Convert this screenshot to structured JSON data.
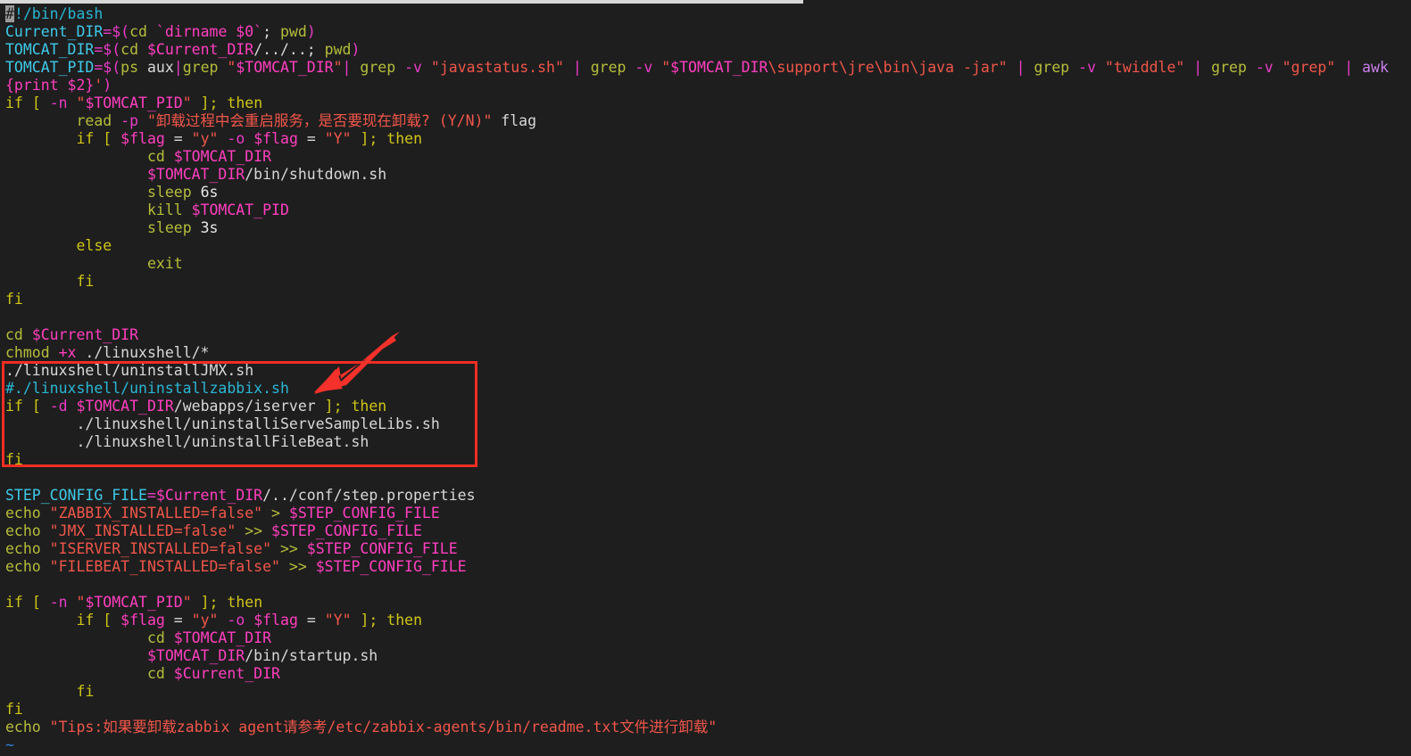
{
  "window": {
    "title": "uninstall.sh",
    "editor": "vim",
    "background_color": "#1e1e1e"
  },
  "annotations": {
    "box": {
      "color": "#ef2d24",
      "shape": "rectangle",
      "highlights_lines": [
        20,
        21,
        22,
        23,
        24,
        25
      ]
    },
    "arrow": {
      "color": "#f4312a",
      "shape": "arrow",
      "direction": "down-left",
      "points_at": "#./linuxshell/uninstallzabbix.sh"
    }
  },
  "filler": {
    "tilde": "~"
  },
  "lines": [
    {
      "n": 1,
      "tokens": [
        {
          "t": "#",
          "c": "cursor"
        },
        {
          "t": "!/bin/bash",
          "c": "c-cmt"
        }
      ]
    },
    {
      "n": 2,
      "tokens": [
        {
          "t": "Current_DIR",
          "c": "c-var"
        },
        {
          "t": "=$(",
          "c": "c-op"
        },
        {
          "t": "cd ",
          "c": "c-cmd"
        },
        {
          "t": "`dirname $0`",
          "c": "c-dollar"
        },
        {
          "t": "; ",
          "c": "c-ident"
        },
        {
          "t": "pwd",
          "c": "c-cmd"
        },
        {
          "t": ")",
          "c": "c-op"
        }
      ]
    },
    {
      "n": 3,
      "tokens": [
        {
          "t": "TOMCAT_DIR",
          "c": "c-var"
        },
        {
          "t": "=$(",
          "c": "c-op"
        },
        {
          "t": "cd ",
          "c": "c-cmd"
        },
        {
          "t": "$Current_DIR",
          "c": "c-dollar"
        },
        {
          "t": "/../..; ",
          "c": "c-ident"
        },
        {
          "t": "pwd",
          "c": "c-cmd"
        },
        {
          "t": ")",
          "c": "c-op"
        }
      ]
    },
    {
      "n": 4,
      "tokens": [
        {
          "t": "TOMCAT_PID",
          "c": "c-var"
        },
        {
          "t": "=$(",
          "c": "c-op"
        },
        {
          "t": "ps ",
          "c": "c-cmd"
        },
        {
          "t": "aux",
          "c": "c-ident"
        },
        {
          "t": "|",
          "c": "c-pipe"
        },
        {
          "t": "grep ",
          "c": "c-cmd"
        },
        {
          "t": "\"",
          "c": "c-str"
        },
        {
          "t": "$TOMCAT_DIR",
          "c": "c-dollar"
        },
        {
          "t": "\"",
          "c": "c-str"
        },
        {
          "t": "| ",
          "c": "c-pipe"
        },
        {
          "t": "grep ",
          "c": "c-cmd"
        },
        {
          "t": "-v ",
          "c": "c-flag"
        },
        {
          "t": "\"javastatus.sh\"",
          "c": "c-str"
        },
        {
          "t": " ",
          "c": "c-ident"
        },
        {
          "t": "| ",
          "c": "c-pipe"
        },
        {
          "t": "grep ",
          "c": "c-cmd"
        },
        {
          "t": "-v ",
          "c": "c-flag"
        },
        {
          "t": "\"",
          "c": "c-str"
        },
        {
          "t": "$TOMCAT_DIR",
          "c": "c-dollar"
        },
        {
          "t": "\\support\\jre\\bin\\java -jar\"",
          "c": "c-str"
        },
        {
          "t": " ",
          "c": "c-ident"
        },
        {
          "t": "| ",
          "c": "c-pipe"
        },
        {
          "t": "grep ",
          "c": "c-cmd"
        },
        {
          "t": "-v ",
          "c": "c-flag"
        },
        {
          "t": "\"twiddle\"",
          "c": "c-str"
        },
        {
          "t": " ",
          "c": "c-ident"
        },
        {
          "t": "| ",
          "c": "c-pipe"
        },
        {
          "t": "grep ",
          "c": "c-cmd"
        },
        {
          "t": "-v ",
          "c": "c-flag"
        },
        {
          "t": "\"grep\"",
          "c": "c-str"
        },
        {
          "t": " ",
          "c": "c-ident"
        },
        {
          "t": "| ",
          "c": "c-pipe"
        },
        {
          "t": "awk",
          "c": "c-awk"
        }
      ]
    },
    {
      "n": 5,
      "tokens": [
        {
          "t": "{print $2}",
          "c": "c-dollar"
        },
        {
          "t": "'",
          "c": "c-str"
        },
        {
          "t": ")",
          "c": "c-op"
        }
      ]
    },
    {
      "n": 6,
      "tokens": [
        {
          "t": "if ",
          "c": "c-kw"
        },
        {
          "t": "[ ",
          "c": "c-punc"
        },
        {
          "t": "-n ",
          "c": "c-flag"
        },
        {
          "t": "\"",
          "c": "c-str"
        },
        {
          "t": "$TOMCAT_PID",
          "c": "c-dollar"
        },
        {
          "t": "\"",
          "c": "c-str"
        },
        {
          "t": " ]; ",
          "c": "c-punc"
        },
        {
          "t": "then",
          "c": "c-kw"
        }
      ]
    },
    {
      "n": 7,
      "tokens": [
        {
          "t": "        ",
          "c": "c-ident"
        },
        {
          "t": "read ",
          "c": "c-cmd"
        },
        {
          "t": "-p ",
          "c": "c-flag"
        },
        {
          "t": "\"卸载过程中会重启服务，是否要现在卸载? (Y/N)\"",
          "c": "c-str"
        },
        {
          "t": " flag",
          "c": "c-ident"
        }
      ]
    },
    {
      "n": 8,
      "tokens": [
        {
          "t": "        ",
          "c": "c-ident"
        },
        {
          "t": "if ",
          "c": "c-kw"
        },
        {
          "t": "[ ",
          "c": "c-punc"
        },
        {
          "t": "$flag",
          "c": "c-dollar"
        },
        {
          "t": " = ",
          "c": "c-ident"
        },
        {
          "t": "\"y\"",
          "c": "c-str"
        },
        {
          "t": " ",
          "c": "c-ident"
        },
        {
          "t": "-o ",
          "c": "c-flag"
        },
        {
          "t": "$flag",
          "c": "c-dollar"
        },
        {
          "t": " = ",
          "c": "c-ident"
        },
        {
          "t": "\"Y\"",
          "c": "c-str"
        },
        {
          "t": " ]; ",
          "c": "c-punc"
        },
        {
          "t": "then",
          "c": "c-kw"
        }
      ]
    },
    {
      "n": 9,
      "tokens": [
        {
          "t": "                ",
          "c": "c-ident"
        },
        {
          "t": "cd ",
          "c": "c-cmd"
        },
        {
          "t": "$TOMCAT_DIR",
          "c": "c-dollar"
        }
      ]
    },
    {
      "n": 10,
      "tokens": [
        {
          "t": "                ",
          "c": "c-ident"
        },
        {
          "t": "$TOMCAT_DIR",
          "c": "c-dollar"
        },
        {
          "t": "/bin/shutdown.sh",
          "c": "c-ident"
        }
      ]
    },
    {
      "n": 11,
      "tokens": [
        {
          "t": "                ",
          "c": "c-ident"
        },
        {
          "t": "sleep ",
          "c": "c-cmd"
        },
        {
          "t": "6s",
          "c": "c-num"
        }
      ]
    },
    {
      "n": 12,
      "tokens": [
        {
          "t": "                ",
          "c": "c-ident"
        },
        {
          "t": "kill ",
          "c": "c-cmd"
        },
        {
          "t": "$TOMCAT_PID",
          "c": "c-dollar"
        }
      ]
    },
    {
      "n": 13,
      "tokens": [
        {
          "t": "                ",
          "c": "c-ident"
        },
        {
          "t": "sleep ",
          "c": "c-cmd"
        },
        {
          "t": "3s",
          "c": "c-num"
        }
      ]
    },
    {
      "n": 14,
      "tokens": [
        {
          "t": "        ",
          "c": "c-ident"
        },
        {
          "t": "else",
          "c": "c-kw"
        }
      ]
    },
    {
      "n": 15,
      "tokens": [
        {
          "t": "                ",
          "c": "c-ident"
        },
        {
          "t": "exit",
          "c": "c-cmd"
        }
      ]
    },
    {
      "n": 16,
      "tokens": [
        {
          "t": "        ",
          "c": "c-ident"
        },
        {
          "t": "fi",
          "c": "c-kw"
        }
      ]
    },
    {
      "n": 17,
      "tokens": [
        {
          "t": "fi",
          "c": "c-kw"
        }
      ]
    },
    {
      "n": 18,
      "tokens": []
    },
    {
      "n": 19,
      "tokens": [
        {
          "t": "cd ",
          "c": "c-cmd"
        },
        {
          "t": "$Current_DIR",
          "c": "c-dollar"
        }
      ]
    },
    {
      "n": 20,
      "tokens": [
        {
          "t": "chmod ",
          "c": "c-cmd"
        },
        {
          "t": "+x",
          "c": "c-dollar"
        },
        {
          "t": " ./linuxshell/*",
          "c": "c-ident"
        }
      ]
    },
    {
      "n": 21,
      "tokens": [
        {
          "t": "./linuxshell/uninstallJMX.sh",
          "c": "c-ident"
        }
      ]
    },
    {
      "n": 22,
      "tokens": [
        {
          "t": "#./linuxshell/uninstallzabbix.sh",
          "c": "c-cmt"
        }
      ]
    },
    {
      "n": 23,
      "tokens": [
        {
          "t": "if ",
          "c": "c-kw"
        },
        {
          "t": "[ ",
          "c": "c-punc"
        },
        {
          "t": "-d ",
          "c": "c-flag"
        },
        {
          "t": "$TOMCAT_DIR",
          "c": "c-dollar"
        },
        {
          "t": "/webapps/iserver",
          "c": "c-ident"
        },
        {
          "t": " ]; ",
          "c": "c-punc"
        },
        {
          "t": "then",
          "c": "c-kw"
        }
      ]
    },
    {
      "n": 24,
      "tokens": [
        {
          "t": "        ./linuxshell/uninstalliServeSampleLibs.sh",
          "c": "c-ident"
        }
      ]
    },
    {
      "n": 25,
      "tokens": [
        {
          "t": "        ./linuxshell/uninstallFileBeat.sh",
          "c": "c-ident"
        }
      ]
    },
    {
      "n": 26,
      "tokens": [
        {
          "t": "fi",
          "c": "c-kw"
        }
      ]
    },
    {
      "n": 27,
      "tokens": []
    },
    {
      "n": 28,
      "tokens": [
        {
          "t": "STEP_CONFIG_FILE",
          "c": "c-var"
        },
        {
          "t": "=",
          "c": "c-op"
        },
        {
          "t": "$Current_DIR",
          "c": "c-dollar"
        },
        {
          "t": "/../conf/step.properties",
          "c": "c-ident"
        }
      ]
    },
    {
      "n": 29,
      "tokens": [
        {
          "t": "echo ",
          "c": "c-cmd"
        },
        {
          "t": "\"ZABBIX_INSTALLED=false\"",
          "c": "c-str"
        },
        {
          "t": " > ",
          "c": "c-cmd"
        },
        {
          "t": "$STEP_CONFIG_FILE",
          "c": "c-dollar"
        }
      ]
    },
    {
      "n": 30,
      "tokens": [
        {
          "t": "echo ",
          "c": "c-cmd"
        },
        {
          "t": "\"JMX_INSTALLED=false\"",
          "c": "c-str"
        },
        {
          "t": " >> ",
          "c": "c-cmd"
        },
        {
          "t": "$STEP_CONFIG_FILE",
          "c": "c-dollar"
        }
      ]
    },
    {
      "n": 31,
      "tokens": [
        {
          "t": "echo ",
          "c": "c-cmd"
        },
        {
          "t": "\"ISERVER_INSTALLED=false\"",
          "c": "c-str"
        },
        {
          "t": " >> ",
          "c": "c-cmd"
        },
        {
          "t": "$STEP_CONFIG_FILE",
          "c": "c-dollar"
        }
      ]
    },
    {
      "n": 32,
      "tokens": [
        {
          "t": "echo ",
          "c": "c-cmd"
        },
        {
          "t": "\"FILEBEAT_INSTALLED=false\"",
          "c": "c-str"
        },
        {
          "t": " >> ",
          "c": "c-cmd"
        },
        {
          "t": "$STEP_CONFIG_FILE",
          "c": "c-dollar"
        }
      ]
    },
    {
      "n": 33,
      "tokens": []
    },
    {
      "n": 34,
      "tokens": [
        {
          "t": "if ",
          "c": "c-kw"
        },
        {
          "t": "[ ",
          "c": "c-punc"
        },
        {
          "t": "-n ",
          "c": "c-flag"
        },
        {
          "t": "\"",
          "c": "c-str"
        },
        {
          "t": "$TOMCAT_PID",
          "c": "c-dollar"
        },
        {
          "t": "\"",
          "c": "c-str"
        },
        {
          "t": " ]; ",
          "c": "c-punc"
        },
        {
          "t": "then",
          "c": "c-kw"
        }
      ]
    },
    {
      "n": 35,
      "tokens": [
        {
          "t": "        ",
          "c": "c-ident"
        },
        {
          "t": "if ",
          "c": "c-kw"
        },
        {
          "t": "[ ",
          "c": "c-punc"
        },
        {
          "t": "$flag",
          "c": "c-dollar"
        },
        {
          "t": " = ",
          "c": "c-ident"
        },
        {
          "t": "\"y\"",
          "c": "c-str"
        },
        {
          "t": " ",
          "c": "c-ident"
        },
        {
          "t": "-o ",
          "c": "c-flag"
        },
        {
          "t": "$flag",
          "c": "c-dollar"
        },
        {
          "t": " = ",
          "c": "c-ident"
        },
        {
          "t": "\"Y\"",
          "c": "c-str"
        },
        {
          "t": " ]; ",
          "c": "c-punc"
        },
        {
          "t": "then",
          "c": "c-kw"
        }
      ]
    },
    {
      "n": 36,
      "tokens": [
        {
          "t": "                ",
          "c": "c-ident"
        },
        {
          "t": "cd ",
          "c": "c-cmd"
        },
        {
          "t": "$TOMCAT_DIR",
          "c": "c-dollar"
        }
      ]
    },
    {
      "n": 37,
      "tokens": [
        {
          "t": "                ",
          "c": "c-ident"
        },
        {
          "t": "$TOMCAT_DIR",
          "c": "c-dollar"
        },
        {
          "t": "/bin/startup.sh",
          "c": "c-ident"
        }
      ]
    },
    {
      "n": 38,
      "tokens": [
        {
          "t": "                ",
          "c": "c-ident"
        },
        {
          "t": "cd ",
          "c": "c-cmd"
        },
        {
          "t": "$Current_DIR",
          "c": "c-dollar"
        }
      ]
    },
    {
      "n": 39,
      "tokens": [
        {
          "t": "        ",
          "c": "c-ident"
        },
        {
          "t": "fi",
          "c": "c-kw"
        }
      ]
    },
    {
      "n": 40,
      "tokens": [
        {
          "t": "fi",
          "c": "c-kw"
        }
      ]
    },
    {
      "n": 41,
      "tokens": [
        {
          "t": "echo ",
          "c": "c-cmd"
        },
        {
          "t": "\"Tips:如果要卸载zabbix agent请参考/etc/zabbix-agents/bin/readme.txt文件进行卸载\"",
          "c": "c-str"
        }
      ]
    }
  ]
}
